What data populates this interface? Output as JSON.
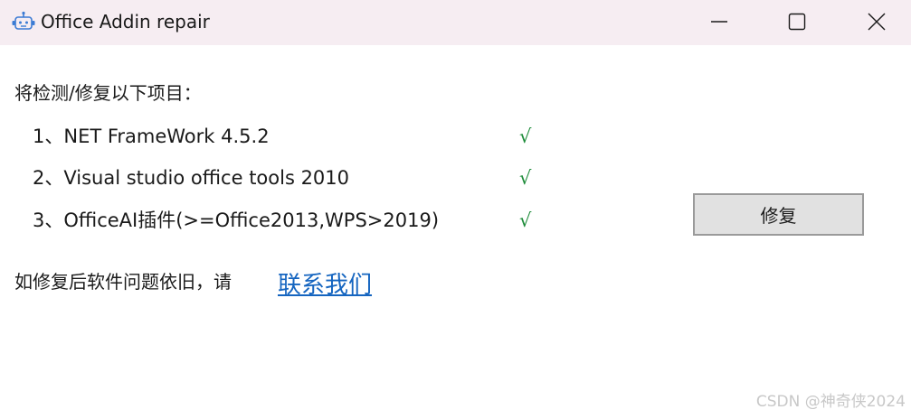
{
  "window": {
    "title": "Office Addin repair",
    "icon": "robot-icon",
    "controls": {
      "minimize_icon": "minimize-icon",
      "maximize_icon": "maximize-icon",
      "close_icon": "close-icon"
    }
  },
  "content": {
    "intro": "将检测/修复以下项目：",
    "items": [
      {
        "label": "1、NET FrameWork 4.5.2",
        "status": "√"
      },
      {
        "label": "2、Visual studio office tools 2010",
        "status": "√"
      },
      {
        "label": "3、OfficeAI插件(>=Office2013,WPS>2019)",
        "status": "√"
      }
    ],
    "repair_button": "修复",
    "footer_text": "如修复后软件问题依旧，请",
    "contact_link": "联系我们"
  },
  "watermark": "CSDN @神奇侠2024",
  "colors": {
    "titlebar_bg": "#f6edf2",
    "check_green": "#1e8c3a",
    "link_blue": "#1565c0",
    "button_bg": "#e1e1e1"
  }
}
